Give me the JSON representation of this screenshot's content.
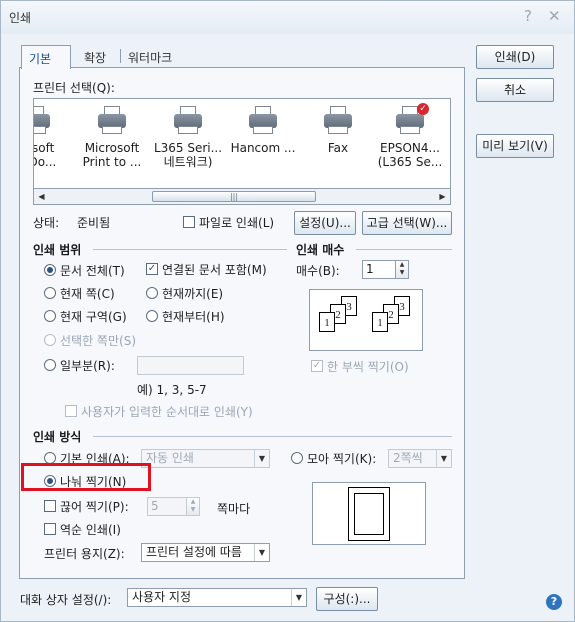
{
  "window": {
    "title": "인쇄",
    "help_glyph": "?",
    "close_glyph": "✕"
  },
  "tabs": [
    "기본",
    "확장",
    "워터마크"
  ],
  "printer_select_label": "프린터 선택(Q):",
  "printers": [
    {
      "line1": "rosoft",
      "line2": "t Do..."
    },
    {
      "line1": "Microsoft",
      "line2": "Print to ..."
    },
    {
      "line1": "L365 Seri...",
      "line2": "네트워크)"
    },
    {
      "line1": "Hancom ...",
      "line2": ""
    },
    {
      "line1": "Fax",
      "line2": ""
    },
    {
      "line1": "EPSON4...",
      "line2": "(L365 Se..."
    }
  ],
  "status": {
    "label": "상태:",
    "value": "준비됨"
  },
  "print_to_file": "파일로 인쇄(L)",
  "settings_button": "설정(U)...",
  "advanced_button": "고급 선택(W)...",
  "range": {
    "title": "인쇄 범위",
    "all": "문서 전체(T)",
    "linked": "연결된 문서 포함(M)",
    "current_page": "현재 쪽(C)",
    "to_current": "현재까지(E)",
    "current_section": "현재 구역(G)",
    "from_current": "현재부터(H)",
    "selection": "선택한 쪽만(S)",
    "part": "일부분(R):",
    "example": "예) 1, 3, 5-7",
    "user_order": "사용자가 입력한 순서대로 인쇄(Y)"
  },
  "copies": {
    "title": "인쇄 매수",
    "label": "매수(B):",
    "value": "1",
    "collate": "한 부씩 찍기(O)"
  },
  "method": {
    "title": "인쇄 방식",
    "basic": "기본 인쇄(A):",
    "basic_value": "자동 인쇄",
    "collect": "모아 찍기(K):",
    "collect_value": "2쪽씩",
    "split": "나눠 찍기(N)",
    "cut": "끊어 찍기(P):",
    "cut_value": "5",
    "per_page": "쪽마다",
    "reverse": "역순 인쇄(I)",
    "paper_label": "프린터 용지(Z):",
    "paper_value": "프린터 설정에 따름"
  },
  "dialog_settings": {
    "label": "대화 상자 설정(/):",
    "value": "사용자 지정",
    "config_button": "구성(:)..."
  },
  "buttons": {
    "print": "인쇄(D)",
    "cancel": "취소",
    "preview": "미리 보기(V)"
  },
  "collate_sheets": [
    "1",
    "2",
    "3"
  ],
  "colors": {
    "highlight": "#e0121f",
    "help": "#2f74c0"
  }
}
